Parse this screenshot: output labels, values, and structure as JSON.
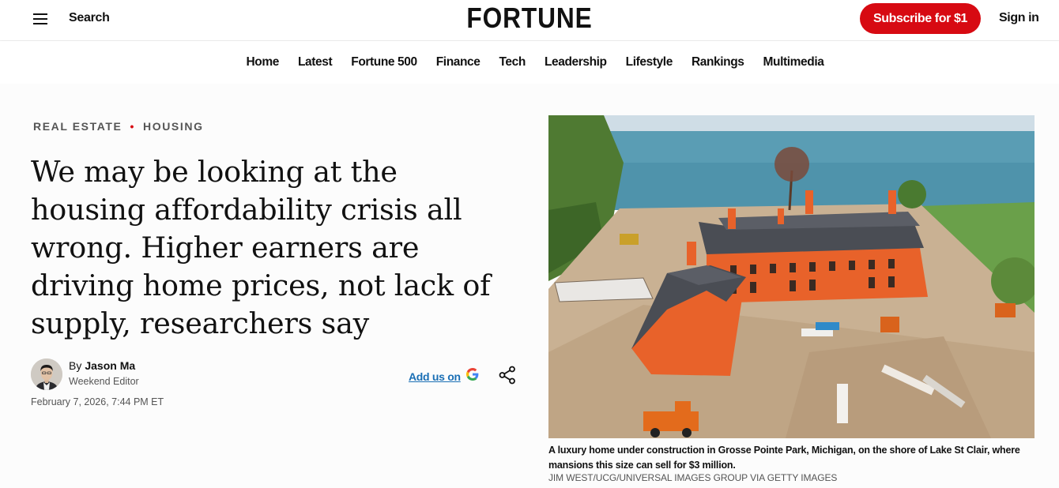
{
  "header": {
    "search_label": "Search",
    "logo": "FORTUNE",
    "subscribe_label": "Subscribe for $1",
    "signin_label": "Sign in"
  },
  "nav": {
    "items": [
      "Home",
      "Latest",
      "Fortune 500",
      "Finance",
      "Tech",
      "Leadership",
      "Lifestyle",
      "Rankings",
      "Multimedia"
    ]
  },
  "article": {
    "eyebrow": [
      "REAL ESTATE",
      "HOUSING"
    ],
    "headline": "We may be looking at the housing affordability crisis all wrong. Higher earners are driving home prices, not lack of supply, researchers say",
    "author": {
      "by": "By",
      "name": "Jason Ma",
      "role": "Weekend Editor"
    },
    "date": "February 7, 2026, 7:44 PM ET",
    "add_us_label": "Add us on",
    "image_caption": "A luxury home under construction in Grosse Pointe Park, Michigan, on the shore of Lake St Clair, where mansions this size can sell for $3 million.",
    "image_credit": "JIM WEST/UCG/UNIVERSAL IMAGES GROUP VIA GETTY IMAGES"
  },
  "colors": {
    "brand_red": "#d70a12",
    "link_blue": "#1a6fb5"
  },
  "icons": {
    "menu": "hamburger-menu-icon",
    "share": "share-icon",
    "google": "google-g-icon"
  }
}
